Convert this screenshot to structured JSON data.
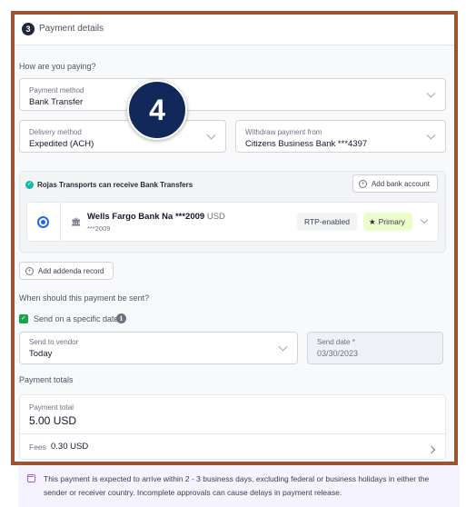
{
  "section": {
    "step": "3",
    "title": "Payment details"
  },
  "paying": {
    "question": "How are you paying?",
    "payment_method": {
      "label": "Payment method",
      "value": "Bank Transfer"
    },
    "delivery_method": {
      "label": "Delivery method",
      "value": "Expedited (ACH)"
    },
    "withdraw_from": {
      "label": "Withdraw payment from",
      "value": "Citizens Business Bank ***4397"
    }
  },
  "bank": {
    "receive_notice": "Rojas Transports can receive Bank Transfers",
    "add_bank_label": "Add bank account",
    "account": {
      "name": "Wells Fargo Bank Na ***2009",
      "currency": "USD",
      "number": "***2009",
      "rtp_badge": "RTP-enabled",
      "primary_badge": "Primary"
    }
  },
  "addenda": {
    "label": "Add addenda record"
  },
  "schedule": {
    "question": "When should this payment be sent?",
    "specific_date_label": "Send on a specific date",
    "send_to_vendor": {
      "label": "Send to vendor",
      "value": "Today"
    },
    "send_date": {
      "label": "Send date *",
      "value": "03/30/2023"
    }
  },
  "totals": {
    "heading": "Payment totals",
    "total_label": "Payment total",
    "total_value": "5.00 USD",
    "fees_label": "Fees",
    "fees_value": "0.30 USD"
  },
  "notice": {
    "text": "This payment is expected to arrive within 2 - 3 business days, excluding federal or business holidays in either the sender or receiver country. Incomplete approvals can cause delays in payment release."
  },
  "callout": {
    "number": "4"
  },
  "colors": {
    "frame": "#a0522d",
    "accent_blue": "#2563eb",
    "callout_bg": "#12275a",
    "primary_badge": "#ecfccb",
    "notice_bg": "#f5f3ff"
  }
}
